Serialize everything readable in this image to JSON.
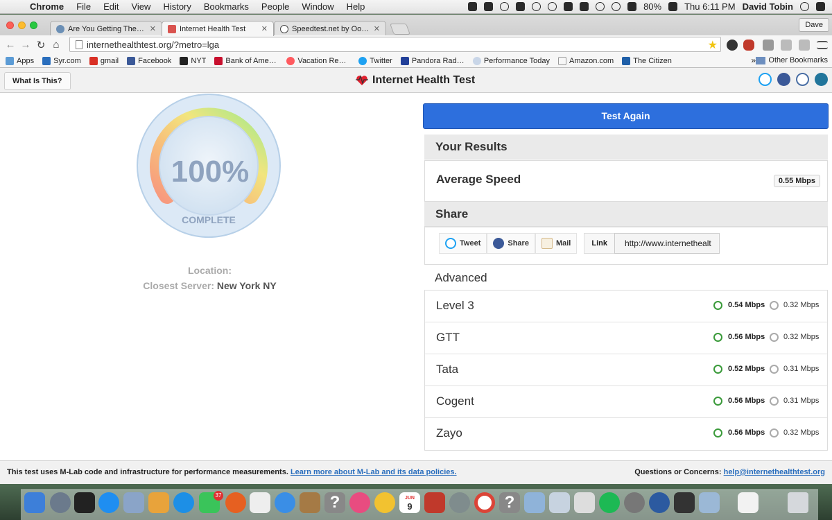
{
  "menubar": {
    "apple_glyph": "",
    "app": "Chrome",
    "items": [
      "File",
      "Edit",
      "View",
      "History",
      "Bookmarks",
      "People",
      "Window",
      "Help"
    ],
    "battery": "80%",
    "clock": "Thu 6:11 PM",
    "user": "David Tobin"
  },
  "browser": {
    "tabs": [
      {
        "title": "Are You Getting The Interne"
      },
      {
        "title": "Internet Health Test"
      },
      {
        "title": "Speedtest.net by Ookla - T"
      }
    ],
    "profile": "Dave",
    "url": "internethealthtest.org/?metro=lga",
    "bookmarks": [
      {
        "label": "Apps"
      },
      {
        "label": "Syr.com"
      },
      {
        "label": "gmail"
      },
      {
        "label": "Facebook"
      },
      {
        "label": "NYT"
      },
      {
        "label": "Bank of America | Ho"
      },
      {
        "label": "Vacation Rentals, Ho"
      },
      {
        "label": "Twitter"
      },
      {
        "label": "Pandora Radio - Listi"
      },
      {
        "label": "Performance Today"
      },
      {
        "label": "Amazon.com"
      },
      {
        "label": "The Citizen"
      }
    ],
    "bookmarks_overflow": "»",
    "other_bookmarks": "Other Bookmarks"
  },
  "site": {
    "what_is_this": "What Is This?",
    "brand": "Internet Health Test",
    "gauge": {
      "percent": "100%",
      "status": "COMPLETE",
      "progress": 1.0
    },
    "location_label": "Location:",
    "server_label": "Closest Server:",
    "server_value": "New York NY",
    "test_again": "Test Again",
    "results_title": "Your Results",
    "avg_speed_label": "Average Speed",
    "avg_speed_value": "0.55 Mbps",
    "share_title": "Share",
    "share_buttons": {
      "tweet": "Tweet",
      "share": "Share",
      "mail": "Mail"
    },
    "link_label": "Link",
    "link_value": "http://www.internethealt",
    "advanced_title": "Advanced",
    "providers": [
      {
        "name": "Level 3",
        "down": "0.54 Mbps",
        "up": "0.32 Mbps"
      },
      {
        "name": "GTT",
        "down": "0.56 Mbps",
        "up": "0.32 Mbps"
      },
      {
        "name": "Tata",
        "down": "0.52 Mbps",
        "up": "0.31 Mbps"
      },
      {
        "name": "Cogent",
        "down": "0.56 Mbps",
        "up": "0.31 Mbps"
      },
      {
        "name": "Zayo",
        "down": "0.56 Mbps",
        "up": "0.32 Mbps"
      }
    ],
    "footer_text": "This test uses M-Lab code and infrastructure for performance measurements.",
    "footer_link": "Learn more about M-Lab and its data policies.",
    "footer_contact_label": "Questions or Concerns:",
    "footer_contact_email": "help@internethealthtest.org"
  },
  "dock": {
    "calendar_month": "JUN",
    "calendar_day": "9",
    "mail_badge": "37"
  },
  "colors": {
    "test_again": "#2d6fdd",
    "link": "#2a6ebd",
    "down_icon": "#3a9a3a"
  }
}
